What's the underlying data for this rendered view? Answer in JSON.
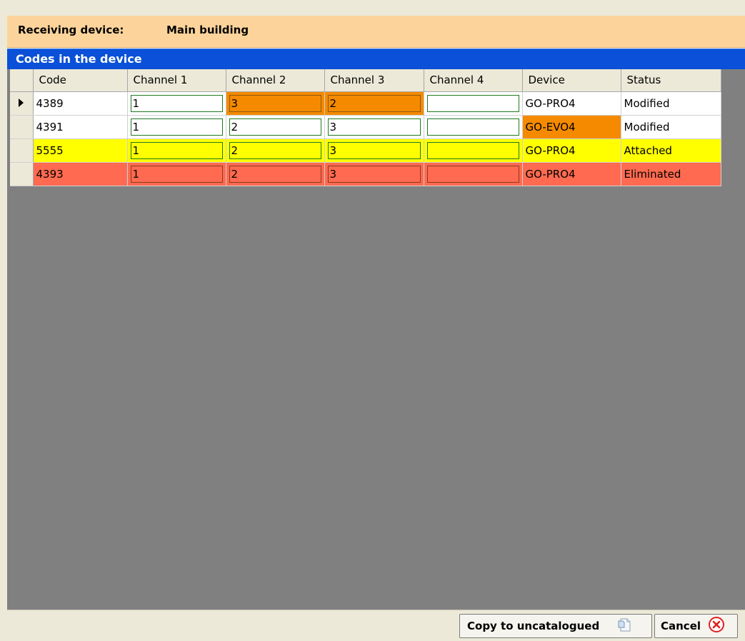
{
  "header": {
    "receiving_label": "Receiving device:",
    "receiving_value": "Main building"
  },
  "panel": {
    "title": "Codes in the device"
  },
  "grid": {
    "columns": [
      "Code",
      "Channel 1",
      "Channel 2",
      "Channel 3",
      "Channel 4",
      "Device",
      "Status"
    ],
    "rows": [
      {
        "code": "4389",
        "ch1": "1",
        "ch2": "3",
        "ch3": "2",
        "ch4": "",
        "device": "GO-PRO4",
        "status": "Modified",
        "selected": true
      },
      {
        "code": "4391",
        "ch1": "1",
        "ch2": "2",
        "ch3": "3",
        "ch4": "",
        "device": "GO-EVO4",
        "status": "Modified",
        "selected": false
      },
      {
        "code": "5555",
        "ch1": "1",
        "ch2": "2",
        "ch3": "3",
        "ch4": "",
        "device": "GO-PRO4",
        "status": "Attached",
        "selected": false
      },
      {
        "code": "4393",
        "ch1": "1",
        "ch2": "2",
        "ch3": "3",
        "ch4": "",
        "device": "GO-PRO4",
        "status": "Eliminated",
        "selected": false
      }
    ]
  },
  "footer": {
    "copy_label": "Copy to uncatalogued",
    "cancel_label": "Cancel"
  },
  "colors": {
    "header_bg": "#fcd49b",
    "title_bar": "#0a50d8",
    "modified_highlight": "#f58a00",
    "attached_row": "#ffff00",
    "eliminated_row": "#ff6a50",
    "grid_empty_bg": "#808080"
  }
}
